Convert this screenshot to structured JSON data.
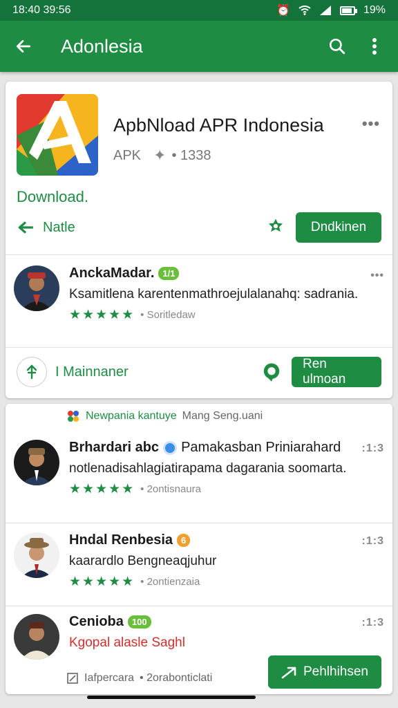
{
  "status_bar": {
    "time": "18:40 39:56",
    "battery": "19%"
  },
  "app_bar": {
    "title": "Adonlesia"
  },
  "app": {
    "name": "ApbNload APR Indonesia",
    "type": "APK",
    "meta": "• 1338",
    "download_link": "Download.",
    "nav_label": "Natle",
    "primary_button": "Dndkinen"
  },
  "featured_review": {
    "name": "AnckaMadar.",
    "badge": "1/1",
    "text": "Ksamitlena karentenmathroejulalanahq: sadrania.",
    "stars": "★★★★★",
    "meta": "• Soritledaw"
  },
  "maintainer_row": {
    "label": "I Mainnaner",
    "button": "Ren ulmoan"
  },
  "notice": {
    "highlight": "Newpania kantuye",
    "rest": "Mang Seng.uani"
  },
  "reviews": [
    {
      "name": "Brhardari abc",
      "title": "Pamakasban Priniarahard",
      "text": "notlenadisahlagiatirapama dagarania soomarta.",
      "stars": "★★★★★",
      "meta": "• 2ontisnaura",
      "dots": ":1:3",
      "badge_color": "#3a8ee6"
    },
    {
      "name": "Hndal Renbesia",
      "badge": "6",
      "text": "kaarardlo Bengneaqjuhur",
      "stars": "★★★★★",
      "meta": "• 2ontienzaia",
      "dots": ":1:3",
      "badge_color": "#f0a030"
    },
    {
      "name": "Cenioba",
      "badge": "100",
      "text": "Kgopal alasle Saghl",
      "meta": "Iafpercara",
      "meta2": "• 2orabonticlati",
      "dots": ":1:3",
      "button": "Pehlhihsen",
      "badge_color": "#6abf3a"
    }
  ]
}
